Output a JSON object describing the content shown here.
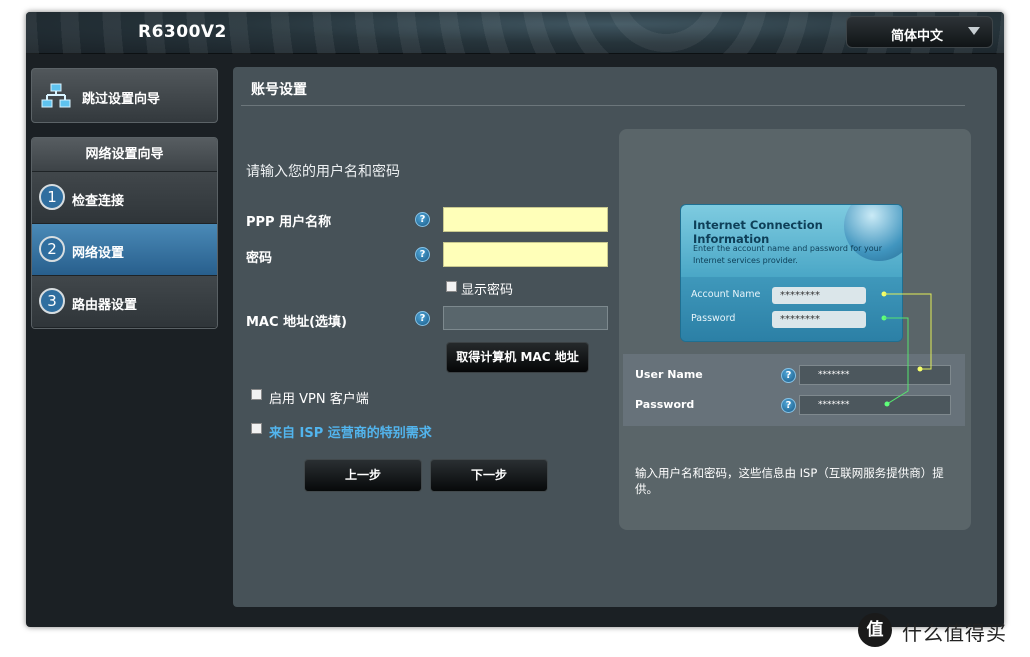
{
  "header": {
    "model": "R6300V2",
    "language": "简体中文"
  },
  "sidebar": {
    "skip_label": "跳过设置向导",
    "wizard_title": "网络设置向导",
    "steps": [
      {
        "num": "1",
        "label": "检查连接"
      },
      {
        "num": "2",
        "label": "网络设置"
      },
      {
        "num": "3",
        "label": "路由器设置"
      }
    ]
  },
  "main": {
    "title": "账号设置",
    "prompt": "请输入您的用户名和密码",
    "ppp_label": "PPP 用户名称",
    "password_label": "密码",
    "show_password": "显示密码",
    "mac_label": "MAC 地址(选填)",
    "mac_button": "取得计算机 MAC 地址",
    "vpn_label": "启用 VPN 客户端",
    "isp_label": "来自 ISP 运营商的特别需求",
    "prev_button": "上一步",
    "next_button": "下一步",
    "help_glyph": "?"
  },
  "illustration": {
    "card_title": "Internet Connection Information",
    "card_sub": "Enter the account name and password for your Internet services provider.",
    "account_label": "Account Name",
    "password_label": "Password",
    "mask": "********",
    "user_label": "User Name",
    "pass_label": "Password",
    "field_mask": "*******",
    "info_text": "输入用户名和密码，这些信息由 ISP（互联网服务提供商）提供。"
  },
  "watermark": {
    "logo": "值",
    "text": "什么值得买"
  },
  "colors": {
    "accent": "#2f6e9f",
    "input_yellow": "#ffffb9",
    "link": "#52b5ee",
    "panel": "#475258"
  }
}
